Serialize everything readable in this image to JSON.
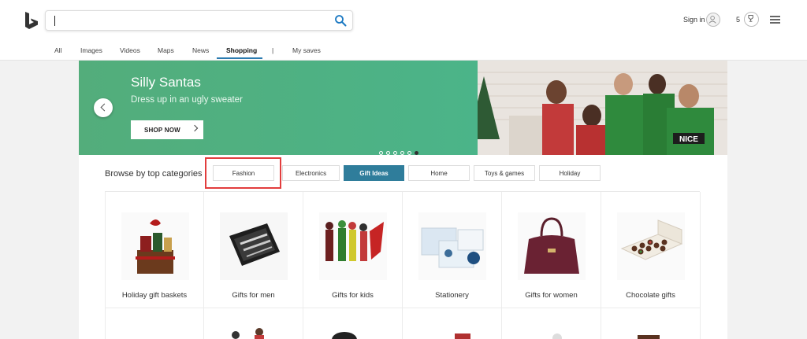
{
  "header": {
    "search": {
      "value": "",
      "placeholder": ""
    },
    "signin_label": "Sign in",
    "rewards_count": "5"
  },
  "nav": [
    {
      "label": "All"
    },
    {
      "label": "Images"
    },
    {
      "label": "Videos"
    },
    {
      "label": "Maps"
    },
    {
      "label": "News"
    },
    {
      "label": "Shopping",
      "active": true
    },
    {
      "label": "|"
    },
    {
      "label": "My saves"
    }
  ],
  "banner": {
    "title": "Silly Santas",
    "subtitle": "Dress up in an ugly sweater",
    "cta_label": "SHOP NOW",
    "slide_count": 6,
    "active_slide": 6
  },
  "browse": {
    "label": "Browse by top categories",
    "categories": [
      {
        "label": "Fashion",
        "highlighted": true
      },
      {
        "label": "Electronics"
      },
      {
        "label": "Gift Ideas",
        "active": true
      },
      {
        "label": "Home"
      },
      {
        "label": "Toys & games"
      },
      {
        "label": "Holiday"
      }
    ]
  },
  "tiles": [
    {
      "label": "Holiday gift baskets",
      "icon": "gift-basket-image"
    },
    {
      "label": "Gifts for men",
      "icon": "grooming-kit-image"
    },
    {
      "label": "Gifts for kids",
      "icon": "action-figures-image"
    },
    {
      "label": "Stationery",
      "icon": "stationery-cards-image"
    },
    {
      "label": "Gifts for women",
      "icon": "handbag-image"
    },
    {
      "label": "Chocolate gifts",
      "icon": "chocolate-box-image"
    }
  ],
  "colors": {
    "accent": "#2c7bb0",
    "active_category": "#2f7d9b",
    "banner_green": "#4fb07d",
    "highlight_box": "#e23d3d"
  }
}
